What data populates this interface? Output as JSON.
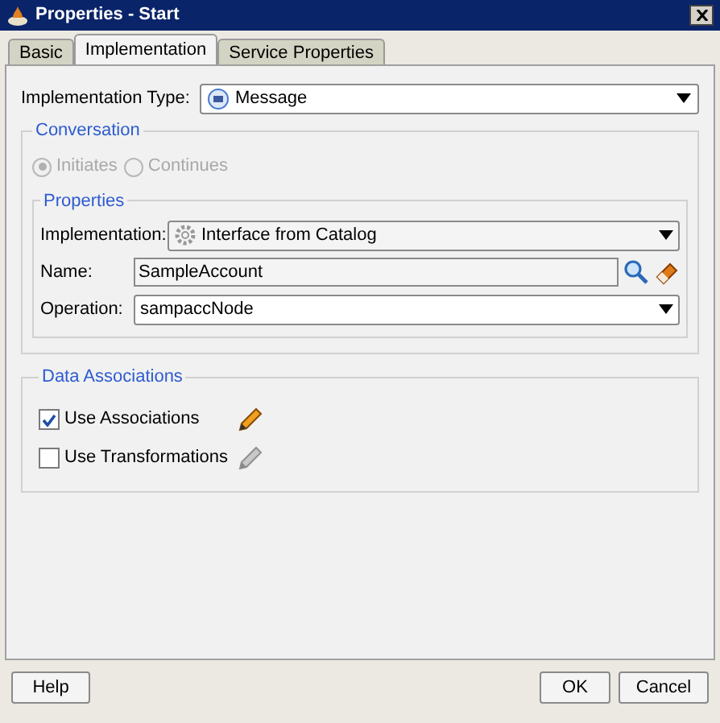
{
  "window": {
    "title": "Properties - Start"
  },
  "tabs": [
    {
      "label": "Basic",
      "selected": false
    },
    {
      "label": "Implementation",
      "selected": true
    },
    {
      "label": "Service Properties",
      "selected": false
    }
  ],
  "implementation_type": {
    "label": "Implementation Type:",
    "value": "Message"
  },
  "conversation": {
    "title": "Conversation",
    "disabled": true,
    "options": [
      {
        "label": "Initiates",
        "selected": true
      },
      {
        "label": "Continues",
        "selected": false
      }
    ],
    "properties": {
      "title": "Properties",
      "implementation": {
        "label": "Implementation:",
        "value": "Interface from Catalog"
      },
      "name": {
        "label": "Name:",
        "value": "SampleAccount"
      },
      "operation": {
        "label": "Operation:",
        "value": "sampaccNode"
      }
    }
  },
  "data_associations": {
    "title": "Data Associations",
    "items": [
      {
        "label": "Use Associations",
        "checked": true
      },
      {
        "label": "Use Transformations",
        "checked": false
      }
    ]
  },
  "buttons": {
    "help": "Help",
    "ok": "OK",
    "cancel": "Cancel"
  }
}
